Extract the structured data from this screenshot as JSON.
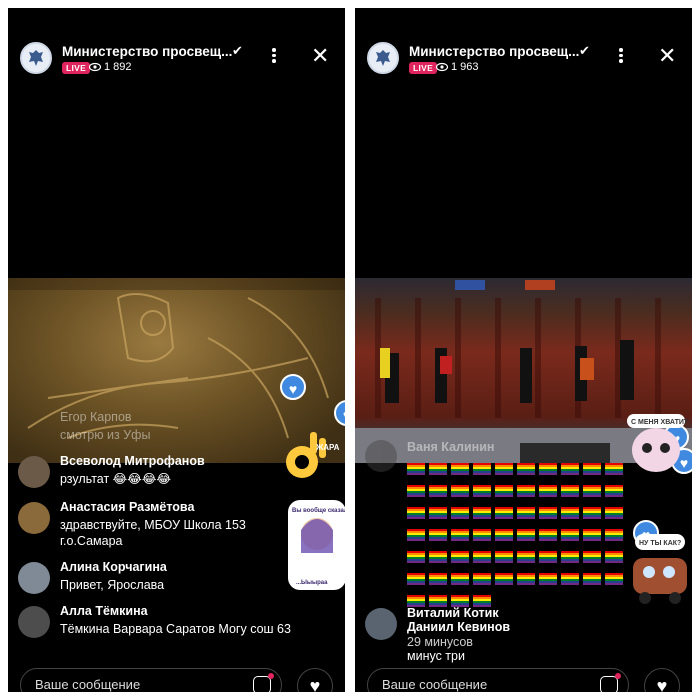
{
  "left": {
    "channel_name": "Министерство просвещ...",
    "live_label": "LIVE",
    "viewers": "1 892",
    "faded_comment": {
      "name": "Егор Карпов",
      "text": "смотрю из Уфы"
    },
    "comments": [
      {
        "name": "Всеволод Митрофанов",
        "text": "рзультат 😂😂😂😂"
      },
      {
        "name": "Анастасия Размётова",
        "text": "здравствуйте, МБОУ Школа 153 г.о.Самара"
      },
      {
        "name": "Алина Корчагина",
        "text": "Привет, Ярослава"
      },
      {
        "name": "Алла Тёмкина",
        "text": "Тёмкина Варвара Саратов Могу сош 63"
      }
    ],
    "input_placeholder": "Ваше сообщение",
    "sticker_text": "Вы вообще сказали? Вы вообще сказали? ...Ыыыраа",
    "ok_sticker_text": "ЖАРА"
  },
  "right": {
    "channel_name": "Министерство просвещ...",
    "live_label": "LIVE",
    "viewers": "1 963",
    "faded_comment": {
      "name": "Ваня Калинин"
    },
    "comments": [
      {
        "name": "Виталий Котик",
        "text": ""
      },
      {
        "name": "Даниил Кевинов",
        "text": "минус три"
      }
    ],
    "overlap_text": "29 минусов",
    "input_placeholder": "Ваше сообщение",
    "sticker_top_text": "С МЕНЯ ХВАТИТ",
    "sticker_bottom_text": "НУ ТЫ КАК?",
    "flag_count": 64
  },
  "colors": {
    "live": "#e0245e",
    "heart": "#3f8ae0",
    "background": "#000000"
  },
  "icons": [
    "verified-check-icon",
    "eye-icon",
    "more-vertical-icon",
    "close-icon",
    "sticker-icon",
    "heart-icon"
  ]
}
